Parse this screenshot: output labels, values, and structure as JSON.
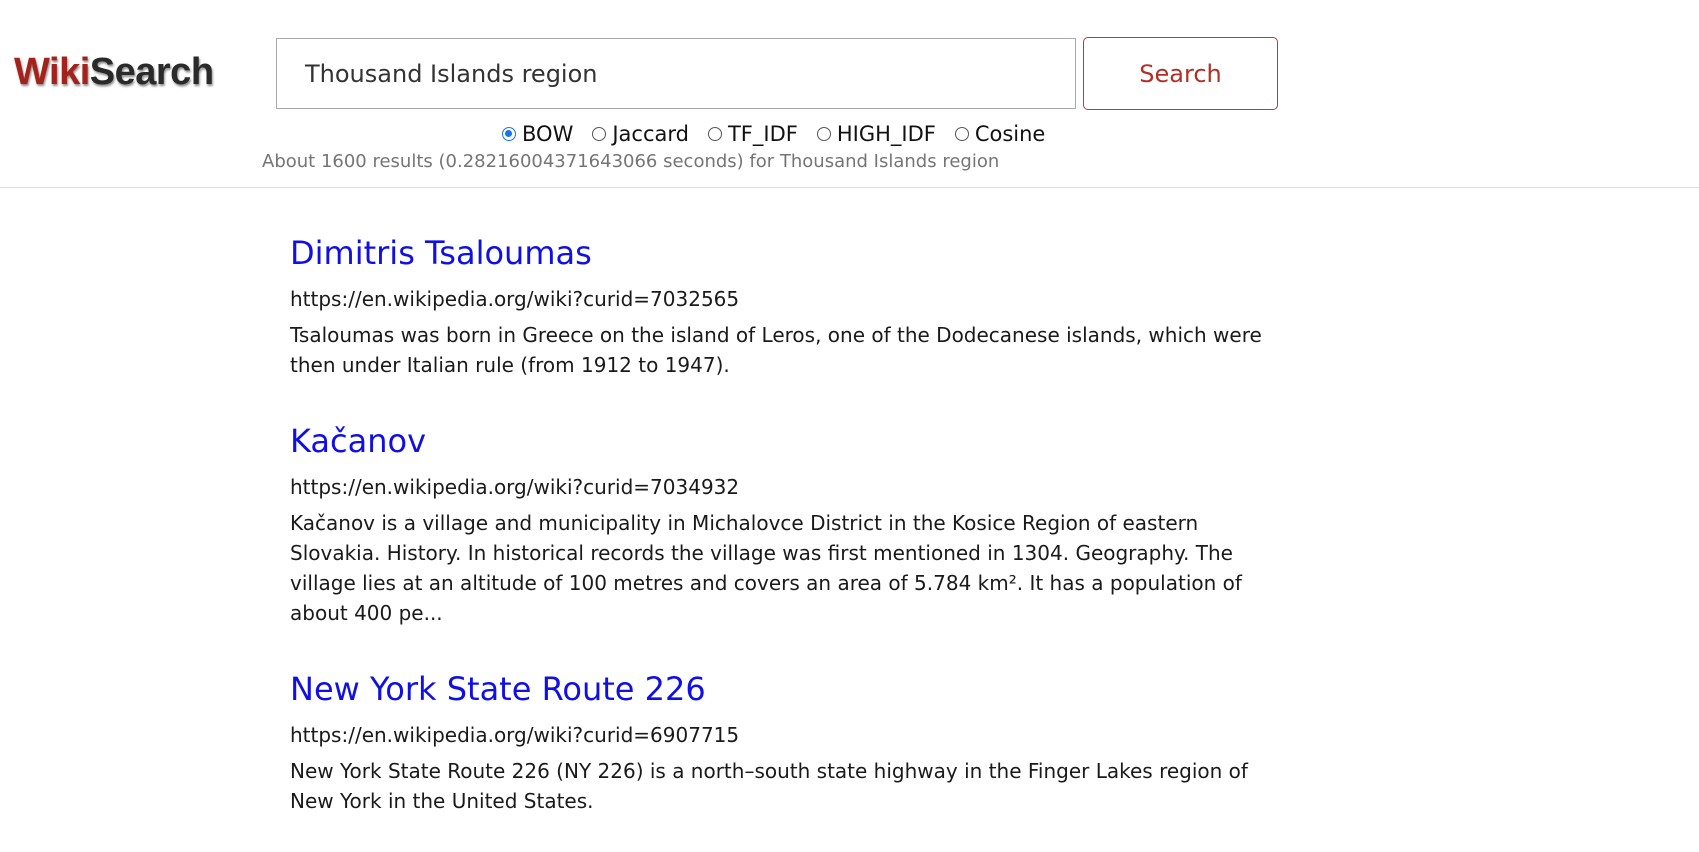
{
  "header": {
    "logo": {
      "part1": "Wiki",
      "part2": "Search"
    },
    "search": {
      "value": "Thousand Islands region",
      "button_label": "Search"
    },
    "algorithms": [
      {
        "label": "BOW",
        "checked": true
      },
      {
        "label": "Jaccard",
        "checked": false
      },
      {
        "label": "TF_IDF",
        "checked": false
      },
      {
        "label": "HIGH_IDF",
        "checked": false
      },
      {
        "label": "Cosine",
        "checked": false
      }
    ],
    "stats": "About 1600 results (0.28216004371643066 seconds) for Thousand Islands region"
  },
  "results": [
    {
      "title": "Dimitris Tsaloumas",
      "url": "https://en.wikipedia.org/wiki?curid=7032565",
      "snippet": "Tsaloumas was born in Greece on the island of Leros, one of the Dodecanese islands, which were then under Italian rule (from 1912 to 1947)."
    },
    {
      "title": "Kačanov",
      "url": "https://en.wikipedia.org/wiki?curid=7034932",
      "snippet": "Kačanov is a village and municipality in Michalovce District in the Kosice Region of eastern Slovakia. History. In historical records the village was first mentioned in 1304. Geography. The village lies at an altitude of 100 metres and covers an area of 5.784 km². It has a population of about 400 pe..."
    },
    {
      "title": "New York State Route 226",
      "url": "https://en.wikipedia.org/wiki?curid=6907715",
      "snippet": "New York State Route 226 (NY 226) is a north–south state highway in the Finger Lakes region of New York in the United States."
    }
  ],
  "colors": {
    "logo_wiki": "#a3221b",
    "logo_search": "#2a2a2a",
    "result_title": "#1010e6",
    "button_accent": "#c0392b",
    "radio_checked": "#1a73e8"
  }
}
